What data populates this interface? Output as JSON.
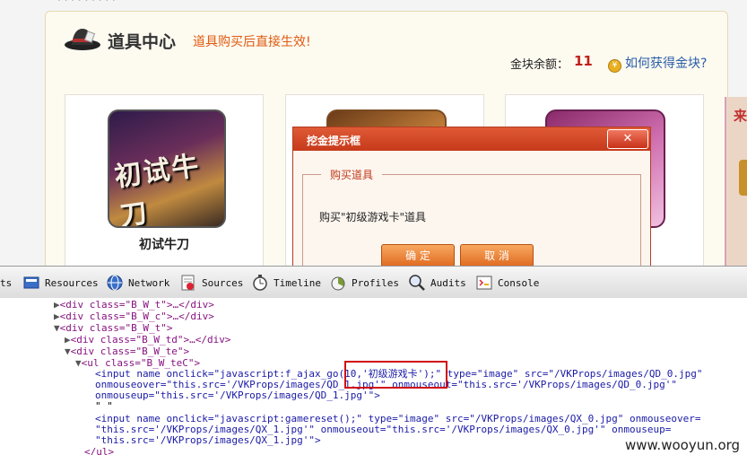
{
  "page": {
    "title": "道具中心",
    "subtitle": "道具购买后直接生效!",
    "gold_label": "金块余额：",
    "gold_value": "11",
    "how_link": "如何获得金块?",
    "side_ad_char": "来",
    "cards": [
      {
        "name": "初试牛刀",
        "art_text": "初试牛刀"
      }
    ]
  },
  "dialog": {
    "title": "挖金提示框",
    "close_symbol": "✕",
    "legend": "购买道具",
    "message": "购买\"初级游戏卡\"道具",
    "ok_label": "确 定",
    "cancel_label": "取 消"
  },
  "devtools": {
    "tabs": [
      {
        "label": "ts",
        "icon": "elements-icon"
      },
      {
        "label": "Resources",
        "icon": "resources-icon"
      },
      {
        "label": "Network",
        "icon": "network-icon"
      },
      {
        "label": "Sources",
        "icon": "sources-icon"
      },
      {
        "label": "Timeline",
        "icon": "timeline-icon"
      },
      {
        "label": "Profiles",
        "icon": "profiles-icon"
      },
      {
        "label": "Audits",
        "icon": "audits-icon"
      },
      {
        "label": "Console",
        "icon": "console-icon"
      }
    ],
    "code": {
      "l1": "<div class=\"B_W_t\">…</div>",
      "l2": "<div class=\"B_W_c\">…</div>",
      "l3": "<div class=\"B_W_t\">",
      "l4": "<div class=\"B_W_td\">…</div>",
      "l5": "<div class=\"B_W_te\">",
      "l6": "<ul class=\"B_W_teC\">",
      "l7": "<input name onclick=\"javascript:f_ajax_go(10,'初级游戏卡');\" type=\"image\" src=\"/VKProps/images/QD_0.jpg\"",
      "l8": "onmouseover=\"this.src='/VKProps/images/QD_1.jpg'\" onmouseout=\"this.src='/VKProps/images/QD_0.jpg'\"",
      "l9": "onmouseup=\"this.src='/VKProps/images/QD_1.jpg'\">",
      "l10": "\" \"",
      "l11": "<input name onclick=\"javascript:gamereset();\" type=\"image\" src=\"/VKProps/images/QX_0.jpg\" onmouseover=",
      "l12": "\"this.src='/VKProps/images/QX_1.jpg'\" onmouseout=\"this.src='/VKProps/images/QX_0.jpg'\" onmouseup=",
      "l13": "\"this.src='/VKProps/images/QX_1.jpg'\">",
      "l14": "</ul>"
    }
  },
  "watermark": "www.wooyun.org",
  "colors": {
    "dialog_bar": "#c63a1a",
    "highlight_box": "#d01010",
    "gold_value": "#c0201a",
    "link": "#2a5ea8"
  }
}
